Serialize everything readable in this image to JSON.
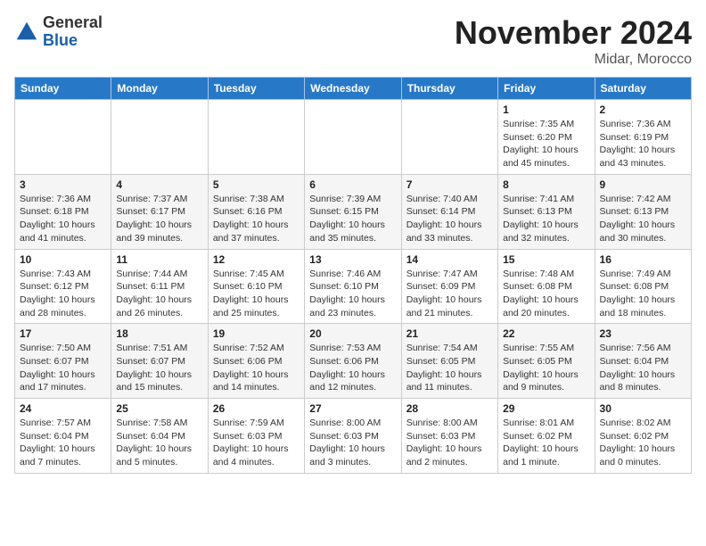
{
  "header": {
    "logo_general": "General",
    "logo_blue": "Blue",
    "month_title": "November 2024",
    "location": "Midar, Morocco"
  },
  "days_of_week": [
    "Sunday",
    "Monday",
    "Tuesday",
    "Wednesday",
    "Thursday",
    "Friday",
    "Saturday"
  ],
  "weeks": [
    [
      {
        "day": "",
        "info": ""
      },
      {
        "day": "",
        "info": ""
      },
      {
        "day": "",
        "info": ""
      },
      {
        "day": "",
        "info": ""
      },
      {
        "day": "",
        "info": ""
      },
      {
        "day": "1",
        "info": "Sunrise: 7:35 AM\nSunset: 6:20 PM\nDaylight: 10 hours\nand 45 minutes."
      },
      {
        "day": "2",
        "info": "Sunrise: 7:36 AM\nSunset: 6:19 PM\nDaylight: 10 hours\nand 43 minutes."
      }
    ],
    [
      {
        "day": "3",
        "info": "Sunrise: 7:36 AM\nSunset: 6:18 PM\nDaylight: 10 hours\nand 41 minutes."
      },
      {
        "day": "4",
        "info": "Sunrise: 7:37 AM\nSunset: 6:17 PM\nDaylight: 10 hours\nand 39 minutes."
      },
      {
        "day": "5",
        "info": "Sunrise: 7:38 AM\nSunset: 6:16 PM\nDaylight: 10 hours\nand 37 minutes."
      },
      {
        "day": "6",
        "info": "Sunrise: 7:39 AM\nSunset: 6:15 PM\nDaylight: 10 hours\nand 35 minutes."
      },
      {
        "day": "7",
        "info": "Sunrise: 7:40 AM\nSunset: 6:14 PM\nDaylight: 10 hours\nand 33 minutes."
      },
      {
        "day": "8",
        "info": "Sunrise: 7:41 AM\nSunset: 6:13 PM\nDaylight: 10 hours\nand 32 minutes."
      },
      {
        "day": "9",
        "info": "Sunrise: 7:42 AM\nSunset: 6:13 PM\nDaylight: 10 hours\nand 30 minutes."
      }
    ],
    [
      {
        "day": "10",
        "info": "Sunrise: 7:43 AM\nSunset: 6:12 PM\nDaylight: 10 hours\nand 28 minutes."
      },
      {
        "day": "11",
        "info": "Sunrise: 7:44 AM\nSunset: 6:11 PM\nDaylight: 10 hours\nand 26 minutes."
      },
      {
        "day": "12",
        "info": "Sunrise: 7:45 AM\nSunset: 6:10 PM\nDaylight: 10 hours\nand 25 minutes."
      },
      {
        "day": "13",
        "info": "Sunrise: 7:46 AM\nSunset: 6:10 PM\nDaylight: 10 hours\nand 23 minutes."
      },
      {
        "day": "14",
        "info": "Sunrise: 7:47 AM\nSunset: 6:09 PM\nDaylight: 10 hours\nand 21 minutes."
      },
      {
        "day": "15",
        "info": "Sunrise: 7:48 AM\nSunset: 6:08 PM\nDaylight: 10 hours\nand 20 minutes."
      },
      {
        "day": "16",
        "info": "Sunrise: 7:49 AM\nSunset: 6:08 PM\nDaylight: 10 hours\nand 18 minutes."
      }
    ],
    [
      {
        "day": "17",
        "info": "Sunrise: 7:50 AM\nSunset: 6:07 PM\nDaylight: 10 hours\nand 17 minutes."
      },
      {
        "day": "18",
        "info": "Sunrise: 7:51 AM\nSunset: 6:07 PM\nDaylight: 10 hours\nand 15 minutes."
      },
      {
        "day": "19",
        "info": "Sunrise: 7:52 AM\nSunset: 6:06 PM\nDaylight: 10 hours\nand 14 minutes."
      },
      {
        "day": "20",
        "info": "Sunrise: 7:53 AM\nSunset: 6:06 PM\nDaylight: 10 hours\nand 12 minutes."
      },
      {
        "day": "21",
        "info": "Sunrise: 7:54 AM\nSunset: 6:05 PM\nDaylight: 10 hours\nand 11 minutes."
      },
      {
        "day": "22",
        "info": "Sunrise: 7:55 AM\nSunset: 6:05 PM\nDaylight: 10 hours\nand 9 minutes."
      },
      {
        "day": "23",
        "info": "Sunrise: 7:56 AM\nSunset: 6:04 PM\nDaylight: 10 hours\nand 8 minutes."
      }
    ],
    [
      {
        "day": "24",
        "info": "Sunrise: 7:57 AM\nSunset: 6:04 PM\nDaylight: 10 hours\nand 7 minutes."
      },
      {
        "day": "25",
        "info": "Sunrise: 7:58 AM\nSunset: 6:04 PM\nDaylight: 10 hours\nand 5 minutes."
      },
      {
        "day": "26",
        "info": "Sunrise: 7:59 AM\nSunset: 6:03 PM\nDaylight: 10 hours\nand 4 minutes."
      },
      {
        "day": "27",
        "info": "Sunrise: 8:00 AM\nSunset: 6:03 PM\nDaylight: 10 hours\nand 3 minutes."
      },
      {
        "day": "28",
        "info": "Sunrise: 8:00 AM\nSunset: 6:03 PM\nDaylight: 10 hours\nand 2 minutes."
      },
      {
        "day": "29",
        "info": "Sunrise: 8:01 AM\nSunset: 6:02 PM\nDaylight: 10 hours\nand 1 minute."
      },
      {
        "day": "30",
        "info": "Sunrise: 8:02 AM\nSunset: 6:02 PM\nDaylight: 10 hours\nand 0 minutes."
      }
    ]
  ]
}
